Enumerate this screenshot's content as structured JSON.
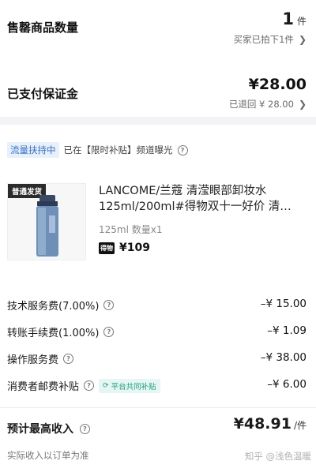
{
  "sold_qty": {
    "label": "售罄商品数量",
    "value": "1",
    "unit": "件",
    "sub": "买家已拍下1件"
  },
  "deposit": {
    "label": "已支付保证金",
    "value": "¥28.00",
    "sub": "已退回 ¥ 28.00"
  },
  "traffic": {
    "badge": "流量扶持中",
    "text": "已在【限时补贴】频道曝光"
  },
  "product": {
    "tag": "普通发货",
    "title": "LANCOME/兰蔻 清滢眼部卸妆水 125ml/200ml#得物双十一好价 清…",
    "spec": "125ml 数量x1",
    "platform_icon": "得物",
    "price": "¥109"
  },
  "fees": [
    {
      "label": "技术服务费(7.00%)",
      "value": "–¥ 15.00"
    },
    {
      "label": "转账手续费(1.00%)",
      "value": "–¥ 1.09"
    },
    {
      "label": "操作服务费",
      "value": "–¥ 38.00"
    },
    {
      "label": "消费者邮费补贴",
      "badge": "平台共同补贴",
      "value": "–¥ 6.00"
    }
  ],
  "income": {
    "label": "预计最高收入",
    "value": "¥48.91",
    "unit": "/件",
    "note": "实际收入以订单为准"
  },
  "watermark": "知乎 @浅色温暖",
  "colors": {
    "blue": "#2f6fd1",
    "green": "#1a9e80",
    "gray_bg": "#f3f3f5"
  },
  "icons": [
    "question-icon",
    "chevron-right-icon",
    "refresh-icon",
    "bottle-image"
  ]
}
